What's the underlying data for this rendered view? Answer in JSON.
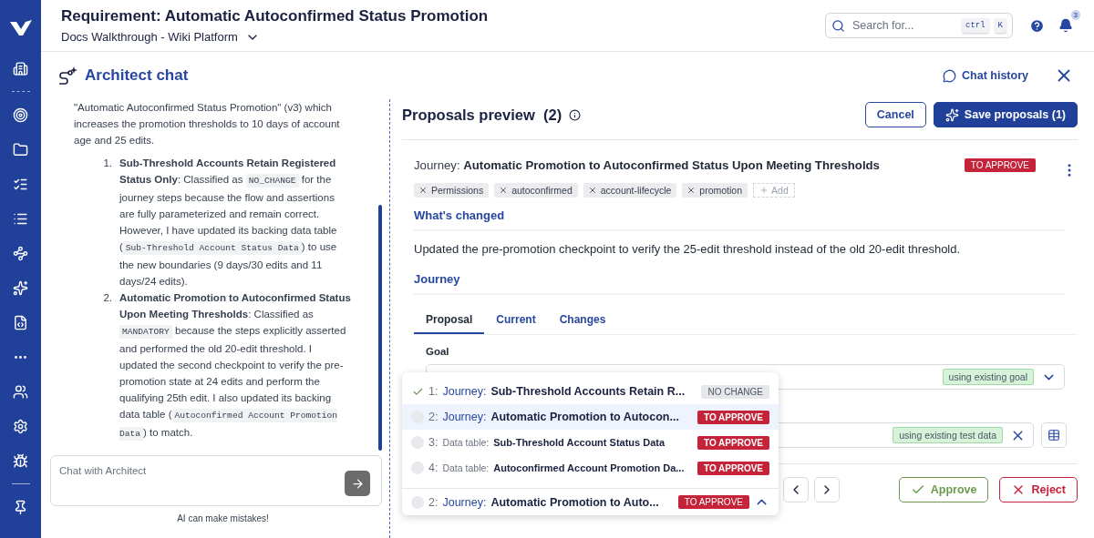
{
  "header": {
    "title": "Requirement: Automatic Autoconfirmed Status Promotion",
    "project": "Docs Walkthrough - Wiki Platform"
  },
  "search": {
    "placeholder": "Search for...",
    "keys": [
      "ctrl",
      "K"
    ]
  },
  "notifications": {
    "count": "3"
  },
  "chat": {
    "title": "Architect chat",
    "history": "Chat history",
    "intro": "\"Automatic Autoconfirmed Status Promotion\" (v3) which increases the promotion thresholds to 10 days of account age and 25 edits.",
    "items": [
      {
        "number": "1.",
        "parts": [
          {
            "kind": "bold",
            "text": "Sub-Threshold Accounts Retain Registered Status Only"
          },
          {
            "kind": "text",
            "text": ": Classified as "
          },
          {
            "kind": "code",
            "text": "NO_CHANGE"
          },
          {
            "kind": "text",
            "text": " for the journey steps because the flow and assertions are fully parameterized and remain correct. However, I have updated its backing data table ("
          },
          {
            "kind": "code",
            "text": "Sub-Threshold Account Status Data"
          },
          {
            "kind": "text",
            "text": ") to use the new boundaries (9 days/30 edits and 11 days/24 edits)."
          }
        ]
      },
      {
        "number": "2.",
        "parts": [
          {
            "kind": "bold",
            "text": "Automatic Promotion to Autoconfirmed Status Upon Meeting Thresholds"
          },
          {
            "kind": "text",
            "text": ": Classified as "
          },
          {
            "kind": "code",
            "text": "MANDATORY"
          },
          {
            "kind": "text",
            "text": " because the steps explicitly asserted and performed the old 20-edit threshold. I updated the second checkpoint to verify the pre-promotion state at 24 edits and perform the qualifying 25th edit. I also updated its backing data table ("
          },
          {
            "kind": "code",
            "text": "Autoconfirmed Account Promotion Data"
          },
          {
            "kind": "text",
            "text": ") to match."
          }
        ]
      }
    ],
    "input": {
      "placeholder": "Chat with Architect"
    },
    "disclaimer": "AI can make mistakes!"
  },
  "proposals": {
    "title": "Proposals preview",
    "count": "(2)",
    "cancel": "Cancel",
    "save": "Save proposals (1)",
    "journey_label": "Journey:",
    "journey_name": "Automatic Promotion to Autoconfirmed Status Upon Meeting Thresholds",
    "status": {
      "text": "TO APPROVE",
      "color": "#c4233a"
    },
    "tags": [
      "Permissions",
      "autoconfirmed",
      "account-lifecycle",
      "promotion"
    ],
    "add_tag": "Add",
    "changed_heading": "What's changed",
    "changed_text": "Updated the pre-promotion checkpoint to verify the 25-edit threshold instead of the old 20-edit threshold.",
    "journey_heading": "Journey",
    "tabs": [
      {
        "label": "Proposal",
        "selected": true
      },
      {
        "label": "Current",
        "selected": false
      },
      {
        "label": "Changes",
        "selected": false
      }
    ],
    "goal_label": "Goal",
    "goal_badge": "using existing goal",
    "data_badge": "using existing test data",
    "approve": "Approve",
    "reject": "Reject"
  },
  "popup": {
    "items": [
      {
        "number": "1:",
        "kind": "journey",
        "type": "Journey:",
        "name": "Sub-Threshold Accounts Retain R...",
        "status": "NO CHANGE",
        "color": "#e6e7ea",
        "approved": true,
        "selected": false
      },
      {
        "number": "2:",
        "kind": "journey",
        "type": "Journey:",
        "name": "Automatic Promotion to Autocon...",
        "status": "TO APPROVE",
        "color": "#c4233a",
        "approved": false,
        "selected": true
      },
      {
        "number": "3:",
        "kind": "data_table",
        "type": "Data table:",
        "name": "Sub-Threshold Account Status Data",
        "status": "TO APPROVE",
        "color": "#c4233a",
        "approved": false,
        "selected": false
      },
      {
        "number": "4:",
        "kind": "data_table",
        "type": "Data table:",
        "name": "Autoconfirmed Account Promotion Da...",
        "status": "TO APPROVE",
        "color": "#c4233a",
        "approved": false,
        "selected": false
      }
    ],
    "current": {
      "number": "2:",
      "kind": "journey",
      "type": "Journey:",
      "name": "Automatic Promotion to Auto...",
      "status": "TO APPROVE",
      "color": "#c4233a",
      "approved": false
    }
  }
}
